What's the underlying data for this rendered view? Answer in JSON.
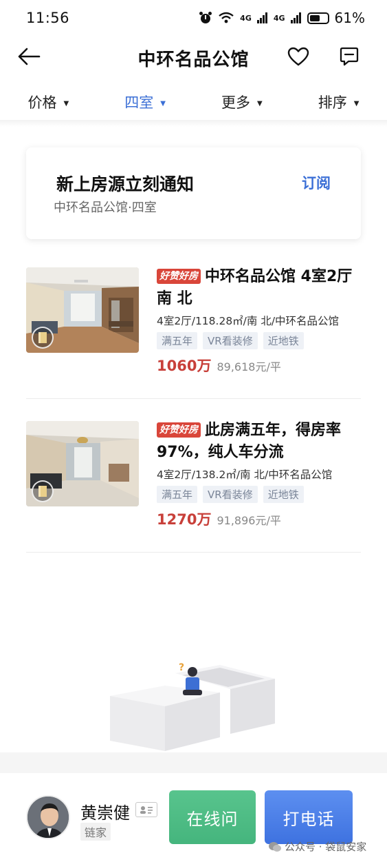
{
  "status": {
    "time": "11:56",
    "signal1": "4G",
    "signal2": "4G",
    "battery": "61%",
    "battery_level": 0.61
  },
  "header": {
    "title": "中环名品公馆"
  },
  "filters": [
    {
      "label": "价格",
      "active": false
    },
    {
      "label": "四室",
      "active": true
    },
    {
      "label": "更多",
      "active": false
    },
    {
      "label": "排序",
      "active": false
    }
  ],
  "notify": {
    "title": "新上房源立刻通知",
    "subtitle": "中环名品公馆·四室",
    "action": "订阅"
  },
  "listings": [
    {
      "badge": "好赞好房",
      "title": "中环名品公馆 4室2厅 南 北",
      "desc": "4室2厅/118.28㎡/南 北/中环名品公馆",
      "tags": [
        "满五年",
        "VR看装修",
        "近地铁"
      ],
      "price": "1060万",
      "unit_price": "89,618元/平"
    },
    {
      "badge": "好赞好房",
      "title": "此房满五年，得房率97%，纯人车分流",
      "desc": "4室2厅/138.2㎡/南 北/中环名品公馆",
      "tags": [
        "满五年",
        "VR看装修",
        "近地铁"
      ],
      "price": "1270万",
      "unit_price": "91,896元/平"
    }
  ],
  "agent": {
    "name": "黄崇健",
    "agency": "链家",
    "chat_label": "在线问",
    "call_label": "打电话"
  },
  "watermark": "公众号 · 袋鼠安家",
  "icons": {
    "back": "arrow-left-icon",
    "favorite": "heart-icon",
    "message": "chat-bubble-icon",
    "caret": "chevron-down-icon",
    "vr": "vr-cube-icon",
    "card": "id-card-icon",
    "wechat": "wechat-icon"
  },
  "colors": {
    "accent_blue": "#3b6fd6",
    "price_red": "#c8403a",
    "chat_green": "#4dba84",
    "call_blue": "#4a7de6",
    "badge_red": "#d9463a"
  }
}
